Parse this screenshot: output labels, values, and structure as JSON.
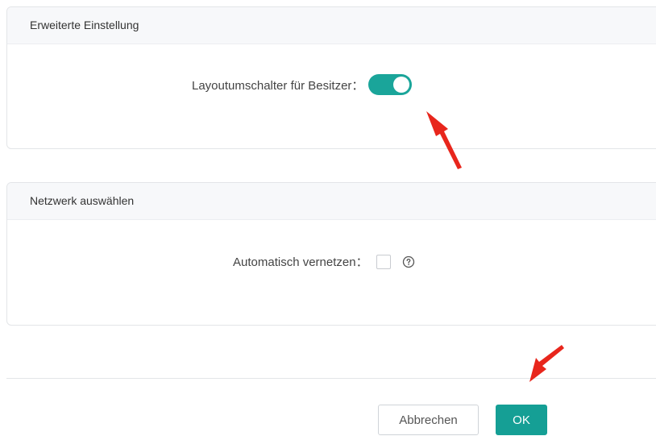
{
  "advanced_settings": {
    "header": "Erweiterte Einstellung",
    "layout_switch_label": "Layoutumschalter für Besitzer：",
    "layout_switch_on": true
  },
  "network_selection": {
    "header": "Netzwerk auswählen",
    "auto_network_label": "Automatisch vernetzen：",
    "auto_network_checked": false,
    "help_icon": "question-circle-icon"
  },
  "footer": {
    "cancel_label": "Abbrechen",
    "ok_label": "OK"
  },
  "colors": {
    "accent": "#1aa59a",
    "ok_button": "#159f95",
    "annotation_arrow": "#e8261c"
  }
}
